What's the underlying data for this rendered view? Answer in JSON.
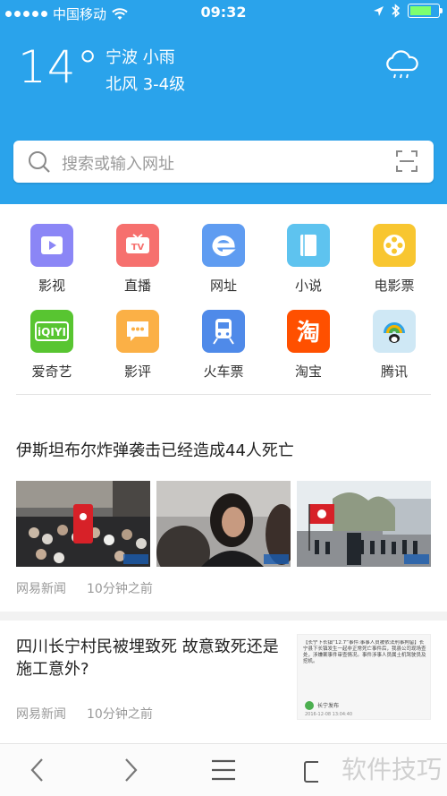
{
  "status_bar": {
    "carrier": "中国移动",
    "time": "09:32",
    "battery_level": 0.8
  },
  "weather": {
    "temperature": "14°",
    "city_condition": "宁波  小雨",
    "wind": "北风 3-4级",
    "icon": "cloud-rain-icon"
  },
  "search": {
    "placeholder": "搜索或输入网址"
  },
  "shortcuts": [
    {
      "label": "影视",
      "icon": "video-icon",
      "color": "#8b86f6"
    },
    {
      "label": "直播",
      "icon": "tv-icon",
      "color": "#f6706e"
    },
    {
      "label": "网址",
      "icon": "e-icon",
      "color": "#5f9cf1"
    },
    {
      "label": "小说",
      "icon": "book-icon",
      "color": "#5ec3ef"
    },
    {
      "label": "电影票",
      "icon": "film-reel-icon",
      "color": "#f8c630"
    },
    {
      "label": "爱奇艺",
      "icon": "iqiyi-logo-icon",
      "color": "#58c531"
    },
    {
      "label": "影评",
      "icon": "chat-bubble-icon",
      "color": "#fbb046"
    },
    {
      "label": "火车票",
      "icon": "train-icon",
      "color": "#4f8ae9"
    },
    {
      "label": "淘宝",
      "icon": "taobao-logo-icon",
      "color": "#ff5000"
    },
    {
      "label": "腾讯",
      "icon": "tencent-logo-icon",
      "color": "#9fd6f0"
    }
  ],
  "news": [
    {
      "title": "伊斯坦布尔炸弹袭击已经造成44人死亡",
      "source": "网易新闻",
      "time": "10分钟之前"
    },
    {
      "title": "四川长宁村民被埋致死 故意致死还是施工意外?",
      "source": "网易新闻",
      "time": "10分钟之前",
      "thumb_text": "【长宁下长镇“12.7”事件:事事人员被依法刑事拘留】长宁县下长镇发生一起非正常死亡事件后，我县公司现场查处，涉嫌案事件审查情况。事件涉事人员属土机驾驶员及挖机。",
      "thumb_source": "长宁发布",
      "thumb_date": "2016-12-08 13:04:40"
    }
  ],
  "watermark": "软件技巧"
}
